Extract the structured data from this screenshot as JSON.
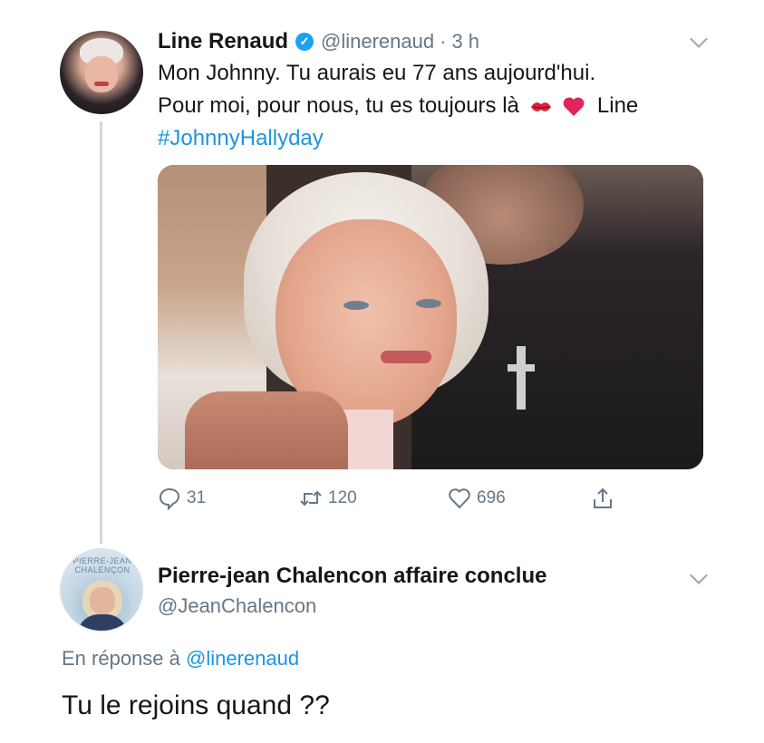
{
  "tweet": {
    "author_name": "Line Renaud",
    "author_handle": "@linerenaud",
    "separator": "·",
    "time": "3 h",
    "text_line1": "Mon Johnny. Tu aurais eu 77 ans aujourd'hui.",
    "text_line2_start": "Pour moi, pour nous, tu es toujours là",
    "text_line2_end": "Line",
    "hashtag": "#JohnnyHallyday",
    "stats": {
      "replies": "31",
      "retweets": "120",
      "likes": "696"
    },
    "icons": [
      "verified-badge-icon",
      "kiss-emoji-icon",
      "heart-emoji-icon",
      "reply-icon",
      "retweet-icon",
      "like-icon",
      "share-icon",
      "chevron-down-icon"
    ]
  },
  "reply": {
    "author_name": "Pierre-jean Chalencon affaire conclue",
    "author_handle": "@JeanChalencon",
    "avatar_logo_text": "PIERRE-JEAN CHALENÇON",
    "in_reply_prefix": "En réponse à",
    "in_reply_handle": "@linerenaud",
    "text": "Tu le rejoins quand ??"
  },
  "colors": {
    "link": "#1b95e0",
    "verified": "#1da1f2",
    "muted": "#657786",
    "text": "#14171a",
    "thread_line": "#cfd9de"
  }
}
